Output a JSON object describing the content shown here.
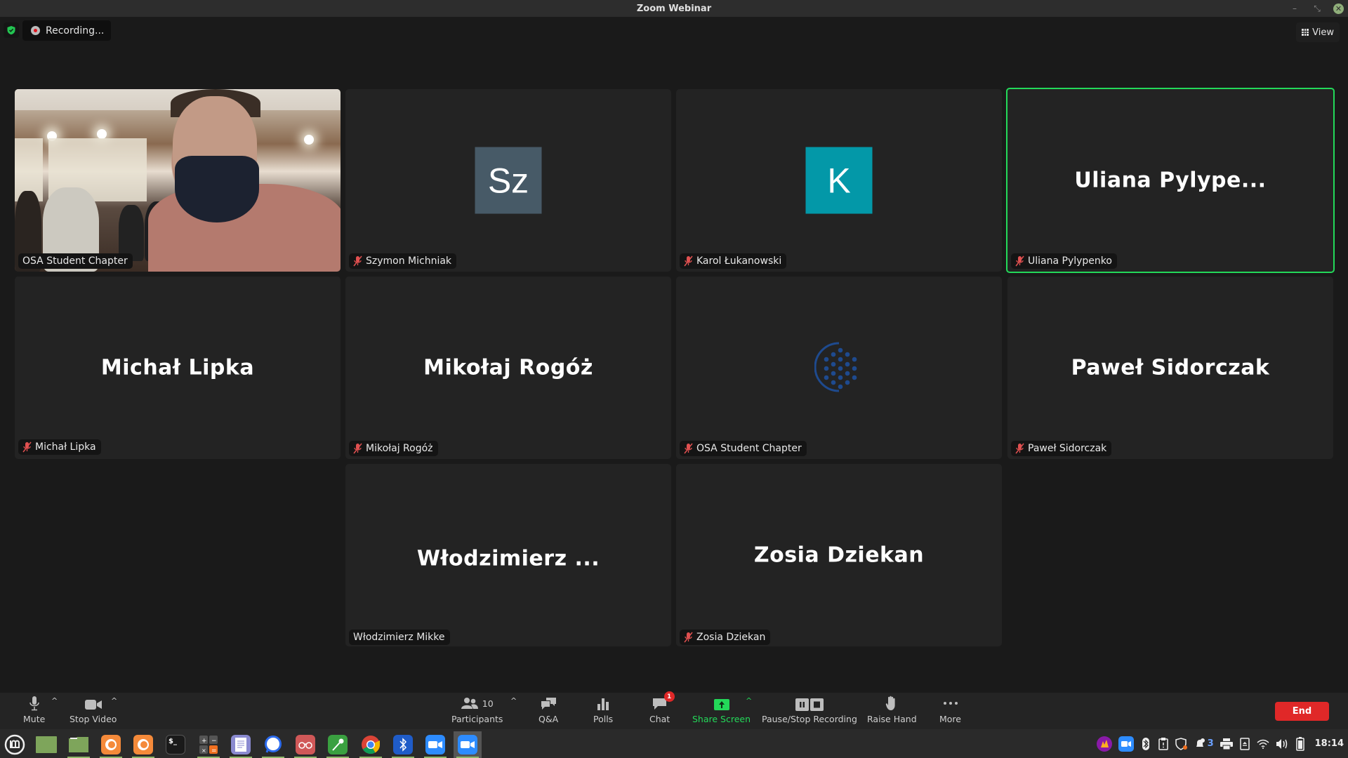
{
  "window": {
    "title": "Zoom Webinar",
    "controls": [
      "minimize",
      "restore",
      "close"
    ]
  },
  "topbar": {
    "security_icon": "shield-check-icon",
    "recording_label": "Recording...",
    "view_label": "View"
  },
  "tiles": [
    {
      "display": "video",
      "tag_name": "OSA Student Chapter",
      "muted": false,
      "active": false
    },
    {
      "display": "avatar",
      "avatar_text": "Sz",
      "avatar_color": "#475a67",
      "tag_name": "Szymon Michniak",
      "muted": true,
      "active": false
    },
    {
      "display": "avatar",
      "avatar_text": "K",
      "avatar_color": "#0398a8",
      "tag_name": "Karol Łukanowski",
      "muted": true,
      "active": false
    },
    {
      "display": "name",
      "big_name": "Uliana Pylype...",
      "tag_name": "Uliana Pylypenko",
      "muted": true,
      "active": true
    },
    {
      "display": "name",
      "big_name": "Michał Lipka",
      "tag_name": "Michał Lipka",
      "muted": true,
      "active": false
    },
    {
      "display": "name",
      "big_name": "Mikołaj Rogóż",
      "tag_name": "Mikołaj Rogóż",
      "muted": true,
      "active": false
    },
    {
      "display": "loading",
      "tag_name": "OSA Student Chapter",
      "muted": true,
      "active": false
    },
    {
      "display": "name",
      "big_name": "Paweł Sidorczak",
      "tag_name": "Paweł Sidorczak",
      "muted": true,
      "active": false
    },
    {
      "display": "name",
      "big_name": "Włodzimierz ...",
      "tag_name": "Włodzimierz Mikke",
      "muted": false,
      "active": false
    },
    {
      "display": "name",
      "big_name": "Zosia Dziekan",
      "tag_name": "Zosia Dziekan",
      "muted": true,
      "active": false
    }
  ],
  "toolbar": {
    "mute_label": "Mute",
    "stop_video_label": "Stop Video",
    "participants_label": "Participants",
    "participants_count": "10",
    "qa_label": "Q&A",
    "polls_label": "Polls",
    "chat_label": "Chat",
    "chat_badge": "1",
    "share_screen_label": "Share Screen",
    "pause_stop_recording_label": "Pause/Stop Recording",
    "raise_hand_label": "Raise Hand",
    "more_label": "More",
    "end_label": "End",
    "accent_green": "#23d959",
    "end_color": "#e02828"
  },
  "taskbar": {
    "apps": [
      {
        "name": "mint-menu",
        "running": false
      },
      {
        "name": "show-desktop",
        "running": false
      },
      {
        "name": "files",
        "running": true
      },
      {
        "name": "firefox",
        "running": true
      },
      {
        "name": "firefox-2",
        "running": true
      },
      {
        "name": "terminal",
        "running": false
      },
      {
        "name": "calculator",
        "running": true
      },
      {
        "name": "text-editor",
        "running": true
      },
      {
        "name": "signal",
        "running": true
      },
      {
        "name": "reader",
        "running": true
      },
      {
        "name": "keyring",
        "running": true
      },
      {
        "name": "chrome",
        "running": true
      },
      {
        "name": "bluetooth",
        "running": true
      },
      {
        "name": "zoom",
        "running": true
      },
      {
        "name": "zoom-webinar",
        "running": true,
        "focused": true
      }
    ],
    "tray": {
      "notification_count": "3",
      "clock": "18:14"
    }
  }
}
